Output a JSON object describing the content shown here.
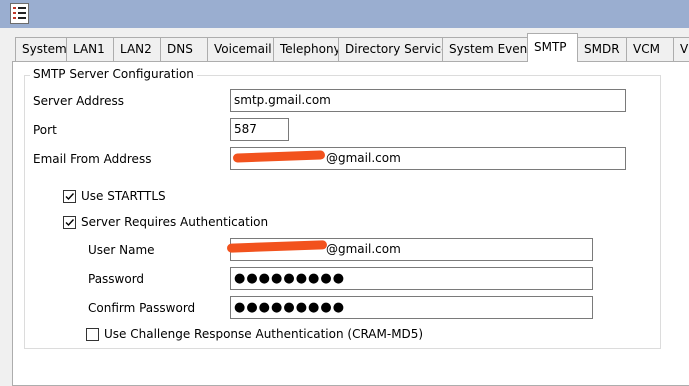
{
  "titlebar": {
    "app_icon": "checklist-icon"
  },
  "tabs": [
    {
      "label": "System",
      "active": false
    },
    {
      "label": "LAN1",
      "active": false
    },
    {
      "label": "LAN2",
      "active": false
    },
    {
      "label": "DNS",
      "active": false
    },
    {
      "label": "Voicemail",
      "active": false
    },
    {
      "label": "Telephony",
      "active": false
    },
    {
      "label": "Directory Services",
      "active": false
    },
    {
      "label": "System Events",
      "active": false
    },
    {
      "label": "SMTP",
      "active": true
    },
    {
      "label": "SMDR",
      "active": false
    },
    {
      "label": "VCM",
      "active": false
    },
    {
      "label": "V",
      "active": false
    }
  ],
  "smtp": {
    "group_title": "SMTP Server Configuration",
    "server_address": {
      "label": "Server Address",
      "value": "smtp.gmail.com"
    },
    "port": {
      "label": "Port",
      "value": "587"
    },
    "email_from": {
      "label": "Email From Address",
      "value": "@gmail.com"
    },
    "use_starttls": {
      "label": "Use STARTTLS",
      "checked": true
    },
    "requires_auth": {
      "label": "Server Requires Authentication",
      "checked": true
    },
    "user_name": {
      "label": "User Name",
      "value": "@gmail.com"
    },
    "password": {
      "label": "Password",
      "value": "●●●●●●●●●"
    },
    "confirm_password": {
      "label": "Confirm Password",
      "value": "●●●●●●●●●"
    },
    "cram_md5": {
      "label": "Use Challenge Response Authentication (CRAM-MD5)",
      "checked": false
    }
  },
  "colors": {
    "redaction": "#f2521d",
    "titlebar": "#9aaed0"
  }
}
